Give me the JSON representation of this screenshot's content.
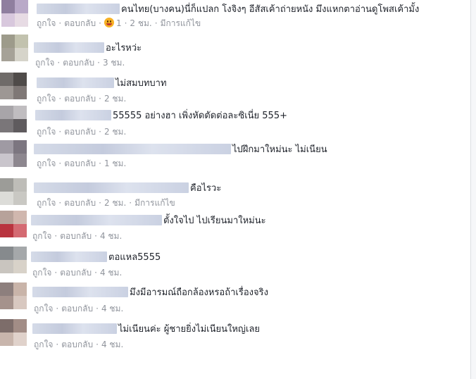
{
  "labels": {
    "like": "ถูกใจ",
    "reply": "ตอบกลับ",
    "dot": "·",
    "edited": "มีการแก้ไข"
  },
  "comments": [
    {
      "text": "คนไทย(บางคน)นี่ก็แปลก โงจิงๆ อีสัสเค้าถ่ายหนัง มึงแหกตาอ่านดูโพสเค้ามั้ง",
      "reaction_count": "1",
      "time": "2 ชม.",
      "edited": true,
      "avatar_colors": [
        "#8f7f9f",
        "#b9a9c8",
        "#d8c8dd",
        "#e7dbe4"
      ],
      "reaction_icon": "haha-emoji-icon"
    },
    {
      "text": "อะไรหว่ะ",
      "time": "3 ชม.",
      "edited": false,
      "avatar_colors": [
        "#9d9b8b",
        "#c2c2ae",
        "#a6a298",
        "#d6d4ca"
      ]
    },
    {
      "text": "ไม่สมบทบาท",
      "time": "2 ชม.",
      "edited": false,
      "avatar_colors": [
        "#6f6b69",
        "#4f4b49",
        "#9d9794",
        "#7f7876"
      ]
    },
    {
      "text": "55555 อย่างฮา เพิ่งหัดตัดต่อละซิเนี่ย 555+",
      "time": "2 ชม.",
      "edited": false,
      "avatar_colors": [
        "#a8a5a9",
        "#c0bdc0",
        "#7a7679",
        "#5f5b5e"
      ]
    },
    {
      "text": "ไปฝึกมาใหม่นะ ไม่เนียน",
      "time": "1 ชม.",
      "edited": false,
      "avatar_colors": [
        "#9f9aa3",
        "#7c7680",
        "#c9c5cc",
        "#8d878f"
      ]
    },
    {
      "text": "คือไรวะ",
      "time": "2 ชม.",
      "edited": true,
      "avatar_colors": [
        "#9c9c98",
        "#bebdb8",
        "#dcdcd8",
        "#c9c8c3"
      ]
    },
    {
      "text": "ตั้งใจไป ไปเรียนมาใหม่นะ",
      "time": "4 ชม.",
      "edited": false,
      "avatar_colors": [
        "#b7a29a",
        "#d0b7ae",
        "#b9343f",
        "#d46a72"
      ]
    },
    {
      "text": "ตอแหล5555",
      "time": "4 ชม.",
      "edited": false,
      "avatar_colors": [
        "#868a8d",
        "#a5a8aa",
        "#c9c5bf",
        "#d8d2c9"
      ]
    },
    {
      "text": "มึงมีอารมณ์ถือกล้องหรอถ้าเรื่องจริง",
      "time": "4 ชม.",
      "edited": false,
      "avatar_colors": [
        "#8d7f7d",
        "#c9b4a9",
        "#a5928c",
        "#d8c8c0"
      ]
    },
    {
      "text": "ไม่เนียนค่ะ ผู้ชายยิ่งไม่เนียนใหญ่เลย",
      "time": "4 ชม.",
      "edited": false,
      "avatar_colors": [
        "#7d6d6a",
        "#a28d86",
        "#c8b5ac",
        "#e0d2cb"
      ]
    }
  ]
}
